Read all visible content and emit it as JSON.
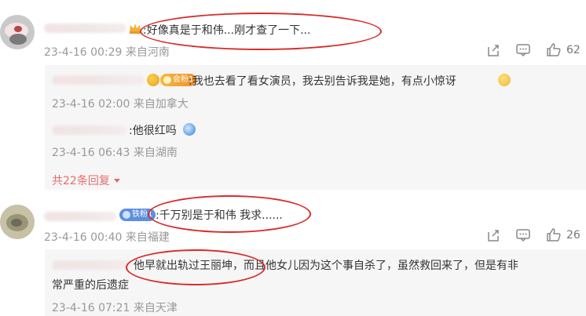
{
  "comments": [
    {
      "text": ":好像真是于和伟...刚才查了一下...",
      "date": "23-4-16 00:29",
      "location": "来自河南",
      "likes": "62",
      "replies": [
        {
          "badge": "会粉1",
          "text": ":我也去看了看女演员，我去别告诉我是她，有点小惊讶",
          "date": "23-4-16 02:00",
          "location": "来自加拿大"
        },
        {
          "text": ":他很红吗",
          "date": "23-4-16 06:43",
          "location": "来自湖南"
        }
      ],
      "more_replies": "共22条回复"
    },
    {
      "badge": "铁粉1",
      "text": ":千万别是于和伟 我求......",
      "date": "23-4-16 00:40",
      "location": "来自福建",
      "likes": "26",
      "replies": [
        {
          "text_line1": "他早就出轨过王丽坤，而且他女儿因为这个事自杀了，虽然救回来了，但是有非",
          "text_line2": "常严重的后遗症",
          "date": "23-4-16 07:21",
          "location": "来自天津"
        }
      ]
    }
  ],
  "colors": {
    "annotation": "#d92b2b",
    "meta_text": "#999999",
    "link_red": "#e86b6b",
    "reply_bg": "#f6f6f6"
  },
  "icons": [
    "share-icon",
    "comment-icon",
    "like-icon",
    "chevron-down-icon",
    "crown-icon",
    "emoji-icon"
  ]
}
